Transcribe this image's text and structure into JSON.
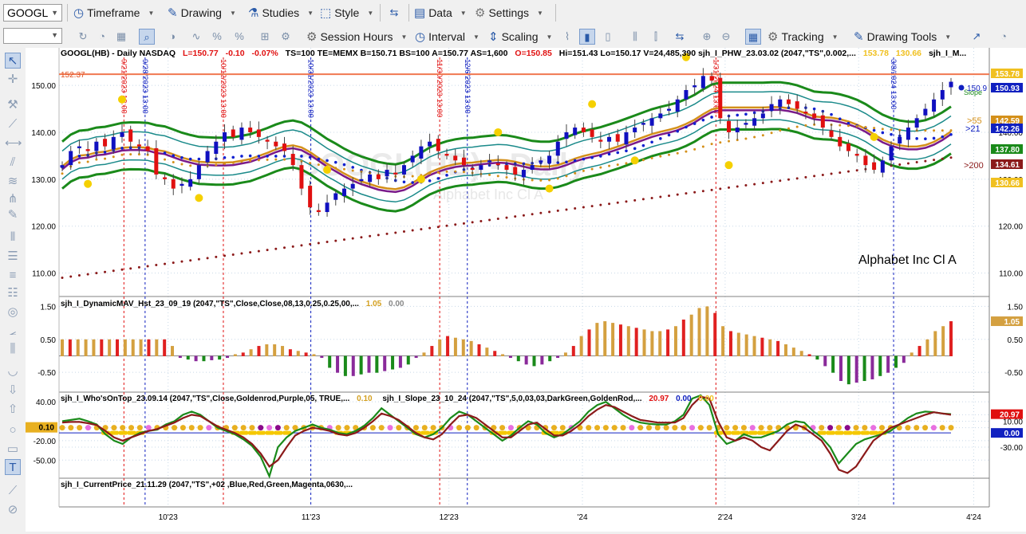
{
  "toolbar": {
    "symbol": "GOOGL",
    "timeframe": "Timeframe",
    "drawing": "Drawing",
    "studies": "Studies",
    "style": "Style",
    "data": "Data",
    "settings": "Settings",
    "session_hours": "Session Hours",
    "interval": "Interval",
    "scaling": "Scaling",
    "tracking": "Tracking",
    "drawing_tools": "Drawing Tools"
  },
  "header": {
    "symbol": "GOOGL(HB) - Daily  NASDAQ",
    "L": "L=150.77",
    "chg": "-0.10",
    "pct": "-0.07%",
    "rest": "TS=100  TE=MEMX  B=150.71  BS=100  A=150.77  AS=1,600",
    "O": "O=150.85",
    "rest2": "Hi=151.43  Lo=150.17  V=24,485,390  sjh_I_PHW_23.03.02 (2047,\"TS\",0.002,...",
    "v1": "153.78",
    "v2": "130.66",
    "tail": "sjh_I_M..."
  },
  "annotations": {
    "company": "Alphabet Inc Cl A",
    "watermark": "GOOGL(HB) - Daily",
    "watermark2": "Alphabet Inc Cl A",
    "line_label": "152.37",
    "lbl55": ">55",
    "lbl21": ">21",
    "lbl200": ">200",
    "slope_label": "Slope",
    "slope_val": "150.9",
    "vlines": [
      "9/21/2023 13:00",
      "9/28/2023 13:00",
      "10/12/2023 13:00",
      "10/31/2023 13:00",
      "11/30/2023 13:00",
      "12/6/2023 13:00",
      "1/31/2024 13:00",
      "3/8/2024 13:00"
    ]
  },
  "panels": {
    "p2_title": "sjh_I_DynamicMAV_Hst_23_09_19 (2047,\"TS\",Close,Close,08,13,0.25,0.25,00,...",
    "p2_v1": "1.05",
    "p2_v2": "0.00",
    "p3_title": "sjh_I_Who'sOnTop_23.09.14 (2047,\"TS\",Close,Goldenrod,Purple,05,  TRUE,...",
    "p3_v1": "0.10",
    "p3_title2": "sjh_I_Slope_23_10_24 (2047,\"TS\",5,0,03,03,DarkGreen,GoldenRod,...",
    "p3_v2": "20.97",
    "p3_v3": "0.00",
    "p3_v4": "0.00",
    "p4_title": "sjh_I_CurrentPrice_21.11.29 (2047,\"TS\",+02 ,Blue,Red,Green,Magenta,0630,..."
  },
  "chart_data": [
    {
      "type": "candlestick",
      "title": "GOOGL(HB) - Daily",
      "x_ticks": [
        "10'23",
        "11'23",
        "12'23",
        "'24",
        "2'24",
        "3'24",
        "4'24"
      ],
      "y_ticks": [
        110,
        120,
        130,
        140,
        150
      ],
      "ylim": [
        105,
        158
      ],
      "horizontal_line": 152.37,
      "right_axis_labels": [
        {
          "text": "153.78",
          "color": "#f0c020"
        },
        {
          "text": "150.93",
          "color": "#1020c0"
        },
        {
          "text": "142.59",
          "color": "#d4901a"
        },
        {
          "text": "142.26",
          "color": "#1020c0"
        },
        {
          "text": "137.80",
          "color": "#1a8a1a"
        },
        {
          "text": "134.61",
          "color": "#8b1a1a"
        },
        {
          "text": "130.66",
          "color": "#f0c020"
        }
      ],
      "close_approx": [
        133,
        136,
        137,
        136,
        138,
        137,
        139,
        140,
        138,
        137,
        136,
        131,
        130,
        128,
        129,
        130,
        133,
        136,
        138,
        140,
        139,
        141,
        140,
        139,
        138,
        137,
        136,
        133,
        128,
        124,
        123,
        125,
        127,
        128,
        129,
        130,
        131,
        130,
        132,
        131,
        133,
        135,
        137,
        138,
        136,
        135,
        134,
        133,
        132,
        133,
        134,
        133,
        132,
        131,
        132,
        133,
        134,
        135,
        138,
        140,
        141,
        140,
        139,
        138,
        139,
        138,
        140,
        141,
        142,
        143,
        144,
        145,
        147,
        149,
        150,
        152,
        151,
        143,
        140,
        141,
        142,
        143,
        144,
        146,
        147,
        146,
        145,
        144,
        143,
        141,
        139,
        137,
        136,
        135,
        133,
        132,
        134,
        137,
        139,
        141,
        143,
        145,
        147,
        149,
        150.77
      ]
    },
    {
      "type": "bar",
      "title": "sjh_I_DynamicMAV_Hst_23_09_19",
      "y_ticks": [
        1.5,
        0.5,
        -0.5
      ],
      "ylim": [
        -1.1,
        1.8
      ],
      "values": [
        0.5,
        0.5,
        0.5,
        0.5,
        0.5,
        0.5,
        0.5,
        0.5,
        0.5,
        0.5,
        0.5,
        0.5,
        0.5,
        0.5,
        0.3,
        -0.05,
        -0.1,
        -0.15,
        -0.15,
        -0.12,
        -0.1,
        -0.05,
        0.05,
        0.1,
        0.2,
        0.3,
        0.35,
        0.35,
        0.3,
        0.2,
        0.15,
        0.1,
        0.05,
        -0.05,
        -0.35,
        -0.5,
        -0.6,
        -0.6,
        -0.55,
        -0.5,
        -0.5,
        -0.45,
        -0.4,
        -0.35,
        -0.25,
        -0.05,
        0.1,
        0.3,
        0.5,
        0.6,
        0.55,
        0.5,
        0.45,
        0.35,
        0.25,
        0.15,
        0.05,
        -0.05,
        -0.15,
        -0.25,
        -0.3,
        -0.25,
        -0.15,
        -0.05,
        0.1,
        0.3,
        0.6,
        0.8,
        1.0,
        1.05,
        1.0,
        0.95,
        0.9,
        0.85,
        0.8,
        0.75,
        0.75,
        0.8,
        0.9,
        1.1,
        1.25,
        1.45,
        1.5,
        1.3,
        0.9,
        0.75,
        0.7,
        0.65,
        0.6,
        0.55,
        0.5,
        0.45,
        0.35,
        0.25,
        0.15,
        0.05,
        -0.1,
        -0.3,
        -0.5,
        -0.75,
        -0.85,
        -0.8,
        -0.75,
        -0.7,
        -0.6,
        -0.5,
        -0.35,
        -0.2,
        0.1,
        0.3,
        0.5,
        0.75,
        0.9,
        1.05
      ]
    },
    {
      "type": "line",
      "title": "sjh_I_Slope_23_10_24",
      "y_ticks": [
        40.0,
        20.0,
        10.0,
        0.0,
        -20.0,
        -30.0,
        -50.0
      ],
      "ylim": [
        -78,
        55
      ],
      "series": [
        {
          "name": "sjh_I_Slope",
          "color": "#1a8a1a",
          "values": [
            10,
            12,
            14,
            10,
            5,
            -10,
            -20,
            -25,
            -15,
            -8,
            -5,
            -3,
            5,
            10,
            20,
            25,
            20,
            10,
            0,
            -5,
            -10,
            -18,
            -28,
            -45,
            -75,
            -30,
            -15,
            -5,
            0,
            5,
            0,
            -3,
            -8,
            -10,
            -5,
            3,
            15,
            30,
            20,
            10,
            0,
            -10,
            -15,
            -10,
            0,
            15,
            25,
            20,
            10,
            0,
            -10,
            -20,
            -12,
            0,
            10,
            5,
            -8,
            -15,
            -10,
            0,
            10,
            25,
            35,
            40,
            30,
            20,
            12,
            8,
            6,
            5,
            5,
            10,
            20,
            45,
            50,
            35,
            -10,
            -25,
            -20,
            -10,
            -15,
            -15,
            -10,
            -5,
            5,
            10,
            8,
            -5,
            -15,
            -30,
            -55,
            -40,
            -25,
            -18,
            -14,
            -10,
            -5,
            5,
            15,
            22,
            25,
            24,
            22,
            20.97
          ]
        },
        {
          "name": "",
          "color": "#8b1a1a",
          "values": [
            8,
            9,
            9,
            7,
            4,
            -5,
            -15,
            -20,
            -15,
            -10,
            -5,
            -2,
            3,
            8,
            15,
            20,
            18,
            10,
            2,
            -3,
            -8,
            -15,
            -25,
            -40,
            -60,
            -50,
            -30,
            -12,
            -5,
            0,
            -2,
            -5,
            -10,
            -12,
            -8,
            0,
            10,
            22,
            18,
            12,
            2,
            -8,
            -15,
            -18,
            -10,
            5,
            18,
            20,
            15,
            5,
            -5,
            -15,
            -15,
            -5,
            5,
            8,
            -2,
            -12,
            -12,
            -5,
            5,
            18,
            28,
            35,
            32,
            25,
            18,
            12,
            10,
            8,
            8,
            8,
            15,
            35,
            48,
            45,
            10,
            -15,
            -20,
            -15,
            -20,
            -30,
            -35,
            -20,
            -5,
            5,
            0,
            -10,
            -20,
            -40,
            -65,
            -70,
            -60,
            -40,
            -20,
            -10,
            0,
            5,
            10,
            15,
            20,
            24,
            22,
            20
          ]
        }
      ]
    }
  ]
}
